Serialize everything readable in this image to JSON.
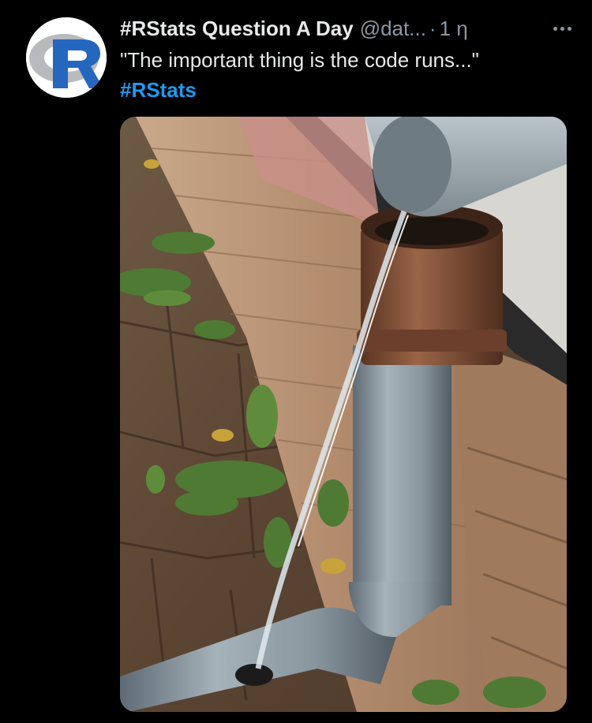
{
  "tweet": {
    "display_name": "#RStats Question A Day",
    "handle": "@dat...",
    "separator": "·",
    "timestamp": "1 η",
    "text": "\"The important thing is the code runs...\"",
    "hashtag": "#RStats",
    "avatar_icon": "r-logo-icon",
    "more_icon": "more-dots-icon"
  },
  "colors": {
    "background": "#000000",
    "text_primary": "#e7e9ea",
    "text_secondary": "#8b98a5",
    "link": "#1d9bf0"
  }
}
